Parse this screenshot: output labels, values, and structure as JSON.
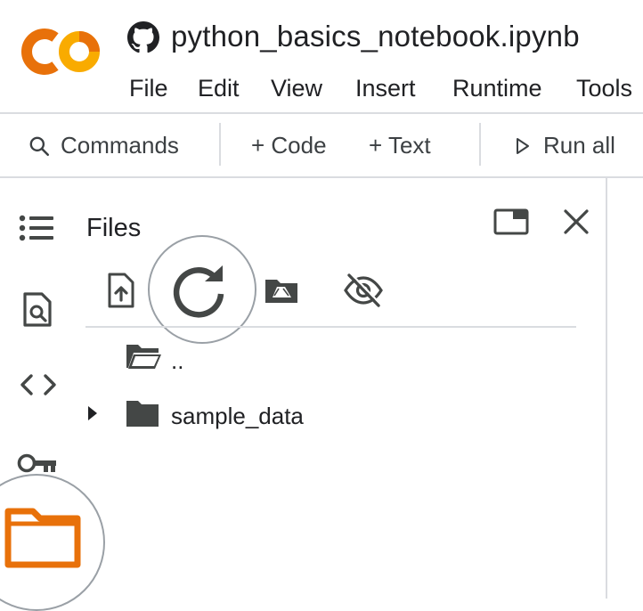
{
  "header": {
    "title": "python_basics_notebook.ipynb",
    "logo_text": "CO",
    "menu": [
      "File",
      "Edit",
      "View",
      "Insert",
      "Runtime",
      "Tools"
    ]
  },
  "toolbar": {
    "commands": "Commands",
    "add_code": "+ Code",
    "add_text": "+ Text",
    "run_all": "Run all"
  },
  "rail": {
    "icons": [
      "table-of-contents-icon",
      "find-icon",
      "code-snippets-icon",
      "secrets-key-icon",
      "files-folder-icon"
    ]
  },
  "files_panel": {
    "title": "Files",
    "toolbar_icons": [
      "upload-icon",
      "refresh-icon",
      "mount-drive-icon",
      "hidden-files-icon"
    ],
    "rows": [
      {
        "name": "..",
        "type": "parent-folder"
      },
      {
        "name": "sample_data",
        "type": "folder"
      }
    ]
  },
  "colors": {
    "logo_orange": "#f9ab00",
    "logo_deep_orange": "#e8710a",
    "active_folder": "#e8710a",
    "icon_gray": "#444746"
  }
}
